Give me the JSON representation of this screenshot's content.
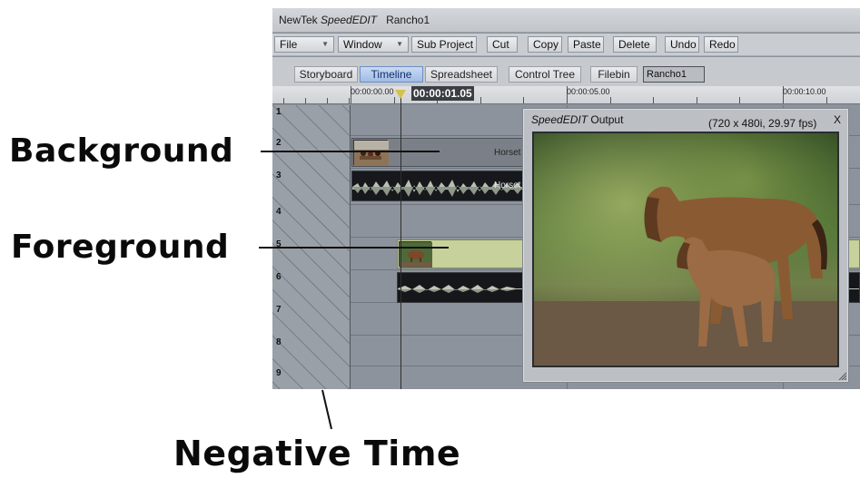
{
  "window": {
    "title_prefix": "NewTek",
    "title_brand": "SpeedEDIT",
    "title_project": "Rancho1"
  },
  "menu": {
    "file": "File",
    "window": "Window",
    "sub_project": "Sub Project",
    "cut": "Cut",
    "copy": "Copy",
    "paste": "Paste",
    "delete": "Delete",
    "undo": "Undo",
    "redo": "Redo"
  },
  "tabs": {
    "storyboard": "Storyboard",
    "timeline": "Timeline",
    "spreadsheet": "Spreadsheet",
    "control_tree": "Control Tree",
    "filebin": "Filebin",
    "project_field_value": "Rancho1"
  },
  "ruler": {
    "t0": "00:00:00.00",
    "playhead_time": "00:00:01.05",
    "t5": "00:00:05.00",
    "t10": "00:00:10.00"
  },
  "tracks": {
    "numbers": [
      "1",
      "2",
      "3",
      "4",
      "5",
      "6",
      "7",
      "8",
      "9"
    ],
    "clip_track2_label": "Horset",
    "clip_track3_label": "Horset"
  },
  "output": {
    "title_brand": "SpeedEDIT",
    "title_word": "Output",
    "format": "(720 x 480i, 29.97 fps)",
    "close": "X"
  },
  "annotations": {
    "background": "Background",
    "foreground": "Foreground",
    "negative_time": "Negative Time"
  },
  "colors": {
    "active_tab": "#9fbbe4",
    "foreground_clip": "#c6d19b",
    "audio_wave": "#b8c0b0"
  }
}
